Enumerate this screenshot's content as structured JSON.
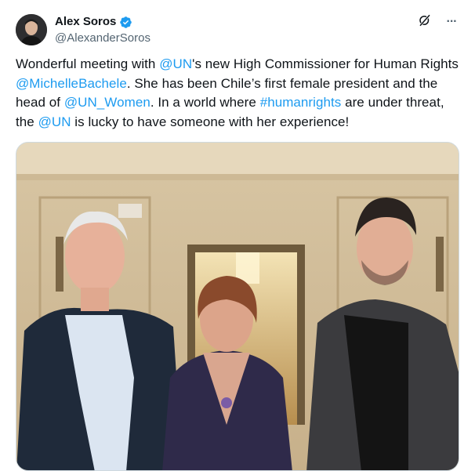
{
  "author": {
    "display_name": "Alex Soros",
    "handle": "@AlexanderSoros",
    "verified_icon": "verified-badge-icon"
  },
  "actions": {
    "grok_icon": "grok-slash-icon",
    "more_icon": "more-dots-icon",
    "more_glyph": "···"
  },
  "tweet": {
    "segments": [
      {
        "text": "Wonderful meeting with ",
        "link": false
      },
      {
        "text": "@UN",
        "link": true
      },
      {
        "text": "'s new High Commissioner for Human Rights ",
        "link": false
      },
      {
        "text": "@MichelleBachele",
        "link": true
      },
      {
        "text": ". She has been Chile’s first female president and the head of ",
        "link": false
      },
      {
        "text": "@UN_Women",
        "link": true
      },
      {
        "text": ". In a world where ",
        "link": false
      },
      {
        "text": "#humanrights",
        "link": true
      },
      {
        "text": " are under threat, the ",
        "link": false
      },
      {
        "text": "@UN",
        "link": true
      },
      {
        "text": " is lucky to have someone with her experience!",
        "link": false
      }
    ]
  },
  "colors": {
    "link": "#1d9bf0",
    "text": "#0f1419",
    "secondary": "#536471",
    "border": "#cfd9de"
  }
}
